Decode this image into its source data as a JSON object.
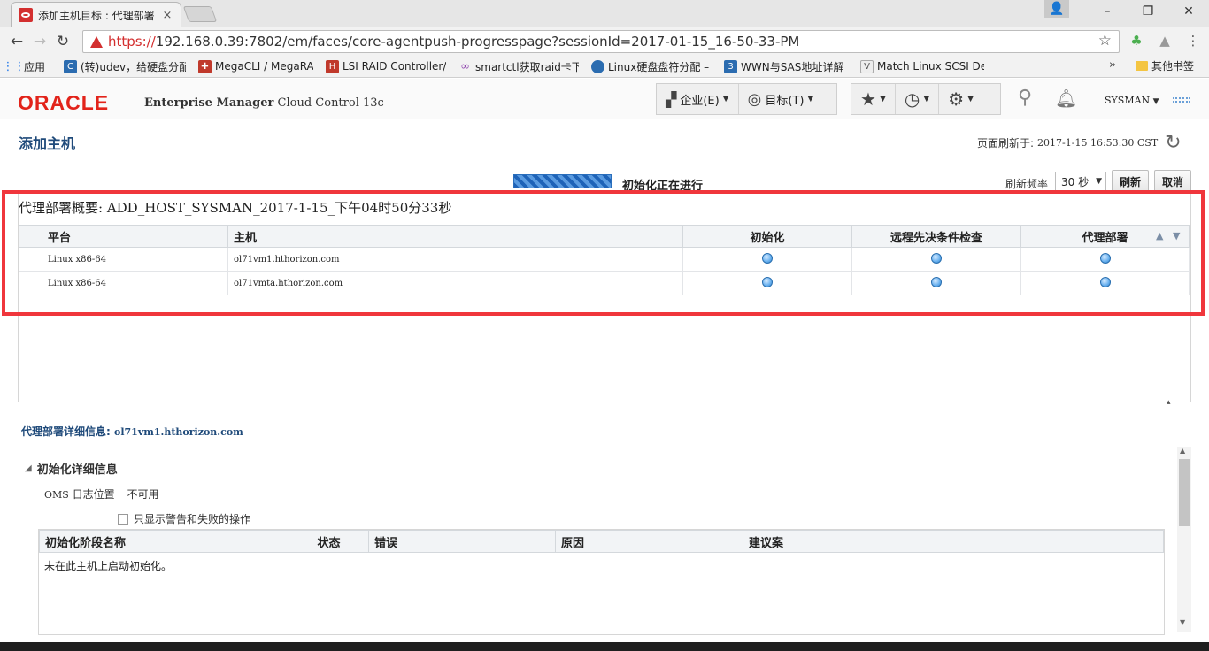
{
  "browser": {
    "tab_title": "添加主机目标 : 代理部署",
    "tab_close": "×",
    "url_scheme": "https://",
    "url_rest": "192.168.0.39:7802/em/faces/core-agentpush-progresspage?sessionId=2017-01-15_16-50-33-PM",
    "bookmarks": [
      {
        "label": "应用",
        "icon": "apps-icon",
        "color": "#1a73e8"
      },
      {
        "label": "(转)udev，给硬盘分配",
        "icon": "site-icon",
        "color": "#2b6cb0"
      },
      {
        "label": "MegaCLI / MegaRAI",
        "icon": "shield-icon",
        "color": "#c0392b"
      },
      {
        "label": "LSI RAID Controller/",
        "icon": "h-icon",
        "color": "#c0392b"
      },
      {
        "label": "smartctl获取raid卡下",
        "icon": "infinity-icon",
        "color": "#8e44ad"
      },
      {
        "label": "Linux硬盘盘符分配 –",
        "icon": "circle-icon",
        "color": "#2b6cb0"
      },
      {
        "label": "WWN与SAS地址详解",
        "icon": "box3-icon",
        "color": "#2b6cb0"
      },
      {
        "label": "Match Linux SCSI De",
        "icon": "v-icon",
        "color": "#555555"
      }
    ],
    "bookmarks_more": "»",
    "other_bookmarks": "其他书签"
  },
  "header": {
    "logo": "ORACLE",
    "product_a": "Enterprise Manager",
    "product_b": "Cloud Control 13c",
    "menu_enterprise": "企业(E)",
    "menu_targets": "目标(T)",
    "user": "SYSMAN"
  },
  "page": {
    "title": "添加主机",
    "refresh_label": "页面刷新于:",
    "refresh_time": "2017-1-15 16:53:30 CST",
    "progress_label": "初始化正在进行",
    "freq_label": "刷新频率",
    "freq_value": "30 秒",
    "refresh_button": "刷新",
    "cancel_button": "取消"
  },
  "summary": {
    "title": "代理部署概要: ADD_HOST_SYSMAN_2017-1-15_下午04时50分33秒",
    "columns": [
      "平台",
      "主机",
      "初始化",
      "远程先决条件检查",
      "代理部署"
    ],
    "rows": [
      {
        "platform": "Linux x86-64",
        "host": "ol71vm1.hthorizon.com",
        "init": "in-progress",
        "prereq": "in-progress",
        "deploy": "in-progress"
      },
      {
        "platform": "Linux x86-64",
        "host": "ol71vmta.hthorizon.com",
        "init": "in-progress",
        "prereq": "in-progress",
        "deploy": "in-progress"
      }
    ]
  },
  "details": {
    "label": "代理部署详细信息:",
    "host": "ol71vm1.hthorizon.com",
    "section_title": "初始化详细信息",
    "oms_log_label_a": "OMS",
    "oms_log_label_b": "日志位置",
    "oms_log_value": "不可用",
    "checkbox_label": "只显示警告和失败的操作",
    "columns": [
      "初始化阶段名称",
      "状态",
      "错误",
      "原因",
      "建议案"
    ],
    "empty_message": "未在此主机上启动初始化。"
  },
  "colors": {
    "accent": "#1f4a7a",
    "oracle_red": "#e2231a",
    "highlight_box": "#f0363c"
  }
}
